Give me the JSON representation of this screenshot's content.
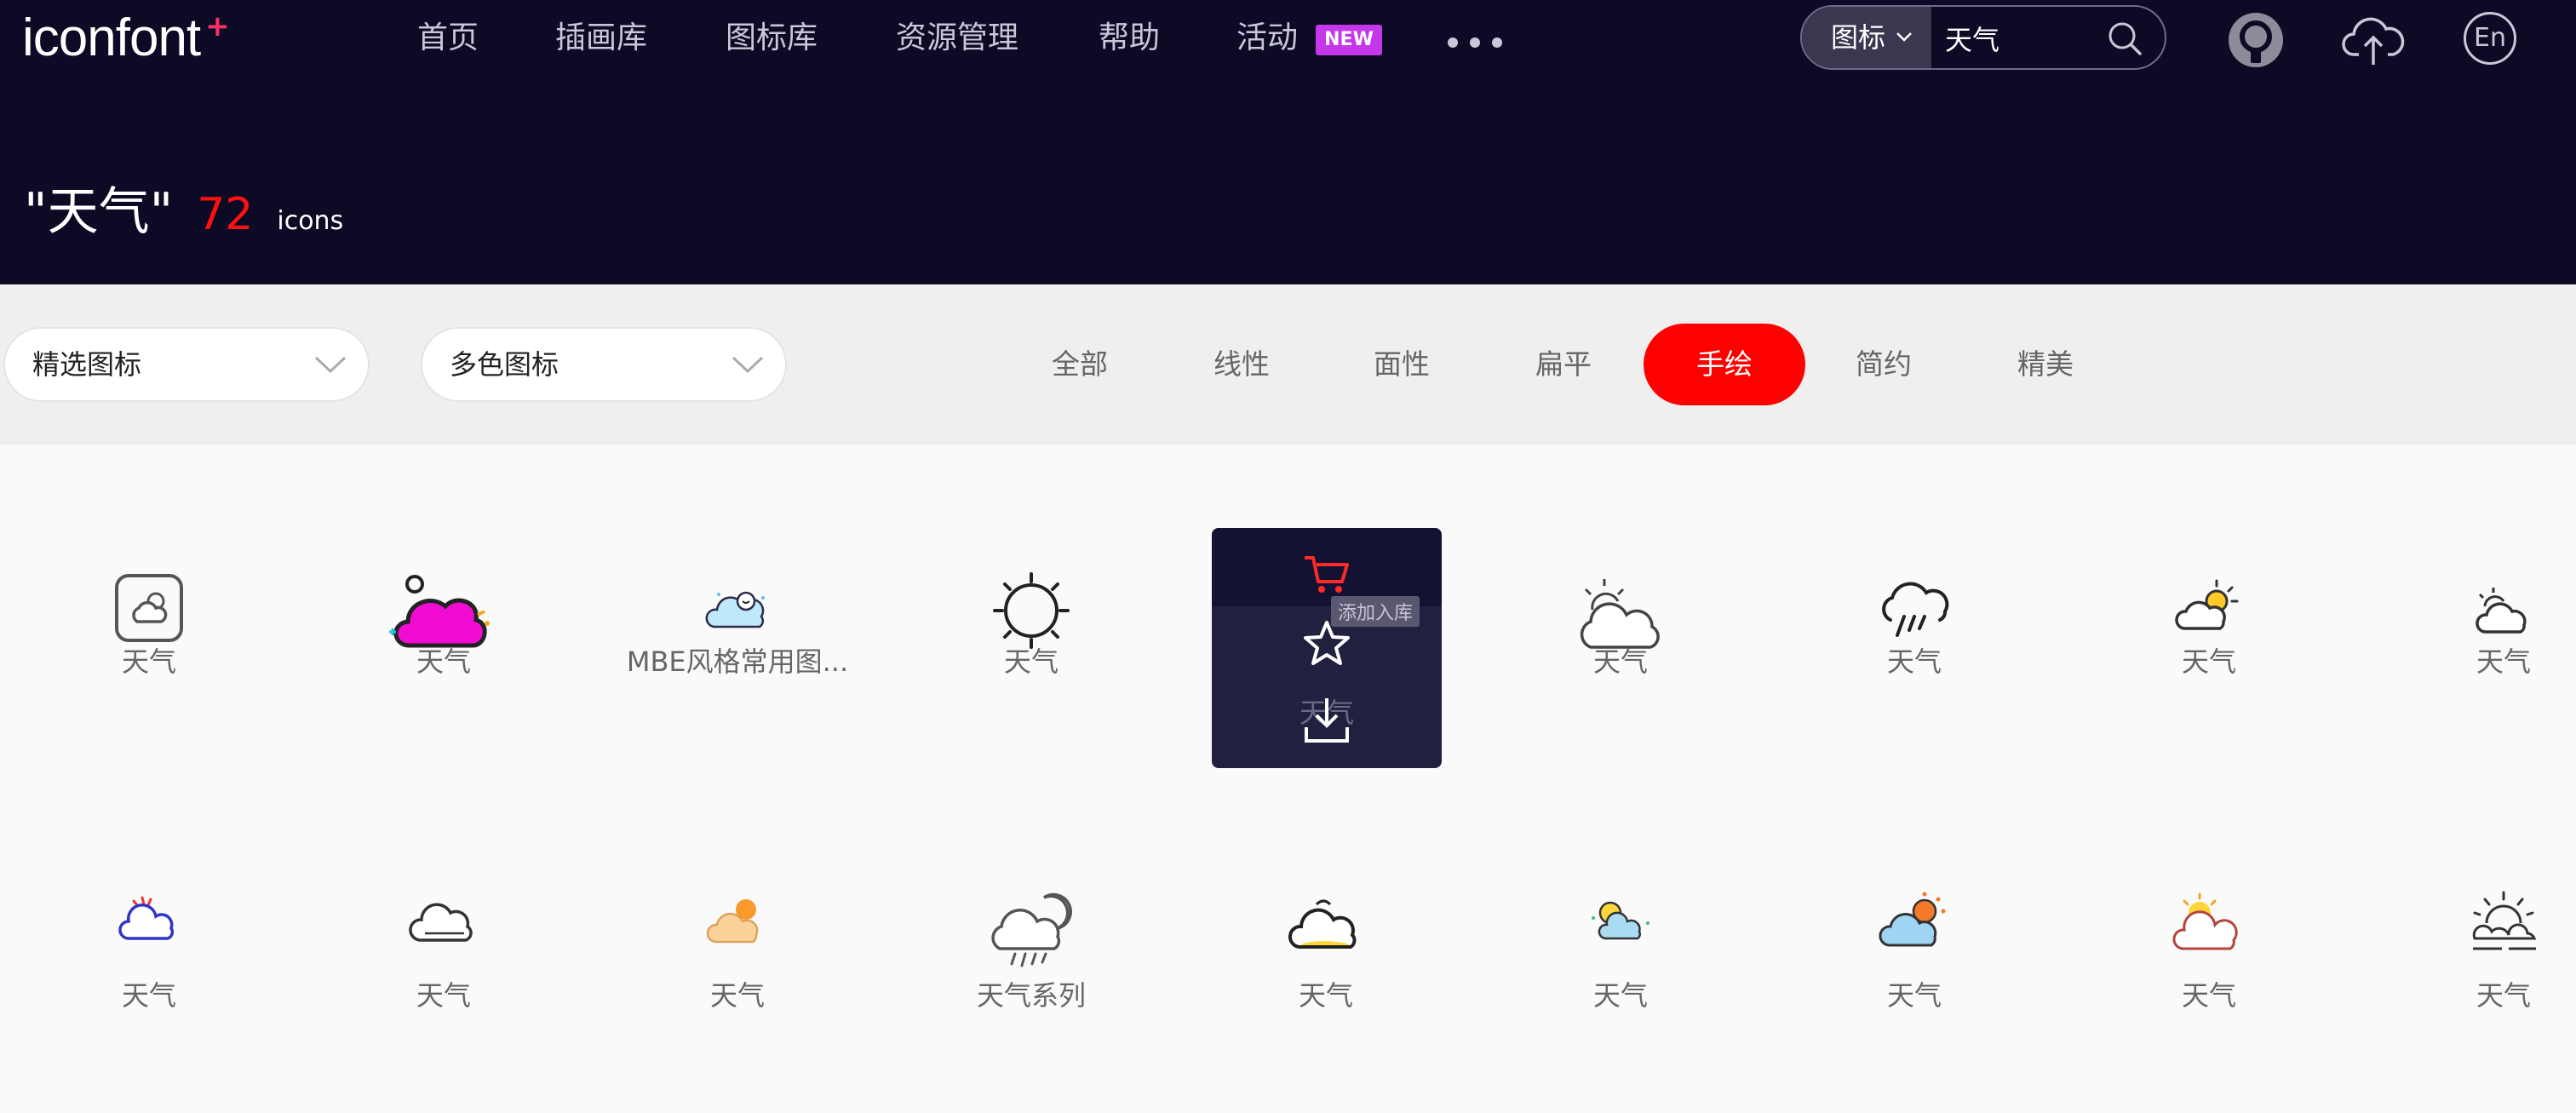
{
  "header": {
    "logo": {
      "text": "iconfont",
      "plus": "+"
    },
    "nav": [
      {
        "label": "首页"
      },
      {
        "label": "插画库"
      },
      {
        "label": "图标库"
      },
      {
        "label": "资源管理"
      },
      {
        "label": "帮助"
      },
      {
        "label": "活动"
      }
    ],
    "new_badge": "NEW",
    "more_icon": "more-dots-icon",
    "search": {
      "type_label": "图标",
      "value": "天气",
      "icon": "search-icon"
    },
    "icons": [
      "avatar-icon",
      "upload-cloud-icon",
      "language-en-icon"
    ],
    "lang_label": "En"
  },
  "page": {
    "query": "\"天气\"",
    "count": "72",
    "count_unit": "icons"
  },
  "filters": {
    "select1": "精选图标",
    "select2": "多色图标",
    "tabs": [
      "全部",
      "线性",
      "面性",
      "扁平",
      "手绘",
      "简约",
      "精美"
    ],
    "active_tab": "手绘"
  },
  "hover_card": {
    "tooltip": "添加入库",
    "ghost_label": "天气",
    "actions": [
      "cart-icon",
      "star-icon",
      "download-icon"
    ]
  },
  "icons_row1": [
    {
      "label": "天气",
      "icon": "rounded-square-weather-icon"
    },
    {
      "label": "天气",
      "icon": "magenta-cloud-icon"
    },
    {
      "label": "MBE风格常用图...",
      "icon": "mbe-snowman-cloud-icon"
    },
    {
      "label": "天气",
      "icon": "sun-outline-icon"
    },
    {
      "label": "天气",
      "icon": "hidden-under-card-icon"
    },
    {
      "label": "天气",
      "icon": "sun-behind-cloud-icon"
    },
    {
      "label": "天气",
      "icon": "rain-cloud-icon"
    },
    {
      "label": "天气",
      "icon": "sun-cloud-color-icon"
    },
    {
      "label": "天气",
      "icon": "small-sun-cloud-icon"
    }
  ],
  "icons_row2": [
    {
      "label": "天气",
      "icon": "blue-cloud-red-sun-icon"
    },
    {
      "label": "天气",
      "icon": "outline-cloud-icon"
    },
    {
      "label": "天气",
      "icon": "orange-sun-cloud-icon"
    },
    {
      "label": "天气系列",
      "icon": "moon-rain-cloud-icon"
    },
    {
      "label": "天气",
      "icon": "yellow-cloud-icon"
    },
    {
      "label": "天气",
      "icon": "sun-face-cloud-icon"
    },
    {
      "label": "天气",
      "icon": "blue-cloud-sun-icon"
    },
    {
      "label": "天气",
      "icon": "sun-red-cloud-icon"
    },
    {
      "label": "天气",
      "icon": "sunrise-horizon-icon"
    }
  ]
}
